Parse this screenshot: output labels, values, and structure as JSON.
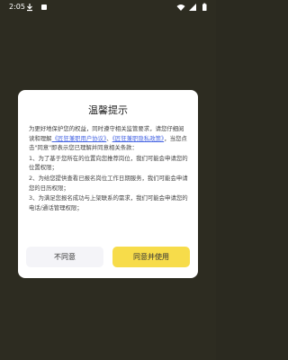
{
  "status_bar": {
    "time": "2:05",
    "left_icons": [
      "download-icon",
      "app-icon"
    ],
    "right_icons": [
      "wifi-icon",
      "signal-icon",
      "battery-icon"
    ]
  },
  "dialog": {
    "title": "温馨提示",
    "intro_pre": "为更好地保护您的权益，同时遵守相关监管要求，请您仔细阅读和理解",
    "link_user": "《匠狂兼职用户协议》",
    "and_text": "、",
    "link_privacy": "《匠狂兼职隐私政策》",
    "intro_post": "，当您点击\"同意\"即表示您已理解并同意相关条款：",
    "items": [
      "1、为了基于您所在的位置向您推荐岗位，我们可能会申请您的位置权限；",
      "2、为给您提供查看已报名岗位工作日期服务，我们可能会申请您的日历权限；",
      "3、为满足您报名成功与上架联系的需求，我们可能会申请您的电话/通话管理权限；"
    ],
    "decline_label": "不同意",
    "accept_label": "同意并使用"
  },
  "colors": {
    "accent": "#f7dc4a",
    "link": "#4766e3",
    "backdrop": "#2d2c21"
  }
}
